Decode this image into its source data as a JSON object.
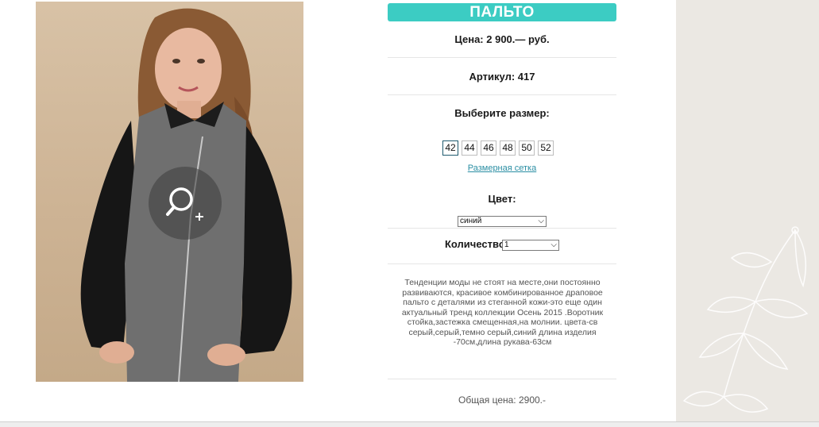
{
  "product": {
    "title": "ПАЛЬТО",
    "price": "Цена: 2 900.— руб.",
    "article": "Артикул: 417",
    "choose_size": "Выберите размер:",
    "sizes": [
      "42",
      "44",
      "46",
      "48",
      "50",
      "52"
    ],
    "selected_size": "42",
    "size_chart_link": "Размерная сетка",
    "color_label": "Цвет:",
    "color_value": "синий",
    "quantity_label": "Количество:",
    "quantity_value": "1",
    "description": "Тенденции моды не стоят на месте,они постоянно развиваются, красивое комбинированное драповое пальто с деталями из стеганной кожи-это еще один актуальный тренд коллекции Осень 2015 .Воротник стойка,застежка смещенная,на молнии. цвета-св серый,серый,темно серый,синий длина изделия -70см,длина рукава-63см",
    "total": "Общая цена: 2900.-"
  },
  "colors": {
    "title_bar": "#3cccc3",
    "link": "#2a8ea3",
    "side_panel": "#ebe8e3"
  },
  "icons": {
    "zoom": "magnifier-plus-icon",
    "dropdown": "chevron-down-icon"
  }
}
